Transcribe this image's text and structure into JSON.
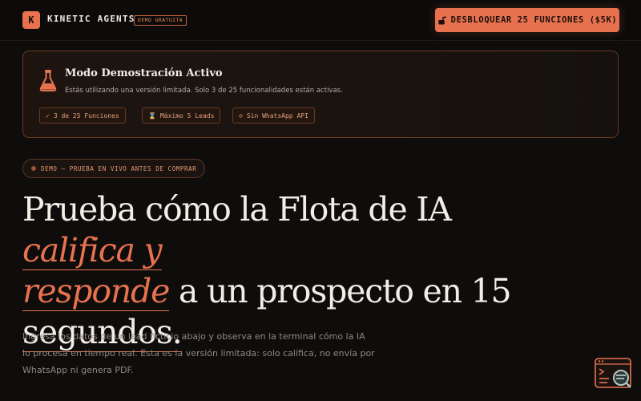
{
  "header": {
    "logo_letter": "K",
    "brand": "KINETIC AGENTS",
    "demo_badge": "DEMO GRATUITA",
    "unlock_label": "DESBLOQUEAR 25 FUNCIONES ($5K)",
    "unlock_icon": "lock-open-icon"
  },
  "demo_card": {
    "icon": "flask-icon",
    "title": "Modo Demostración Activo",
    "subtitle": "Estás utilizando una versión limitada. Solo 3 de 25 funcionalidades están activas.",
    "chips": [
      {
        "icon": "check-icon",
        "label": "3 de 25 Funciones"
      },
      {
        "icon": "hourglass-icon",
        "label": "Máximo 5 Leads"
      },
      {
        "icon": "ban-icon",
        "label": "Sin WhatsApp API"
      }
    ]
  },
  "tag": "DEMO — PRUEBA EN VIVO ANTES DE COMPRAR",
  "hero": {
    "part1": "Prueba cómo la Flota de IA ",
    "highlight1": "califica y",
    "highlight2": "responde",
    "part2": " a un prospecto en 15",
    "highlight3": "segundos.",
    "highlight3_note": ""
  },
  "description": "Ingresa los datos de un lead ficticio abajo y observa en la terminal cómo la IA lo procesa en tiempo real. Esta es la versión limitada: solo califica, no envía por WhatsApp ni genera PDF.",
  "floating_icon": "terminal-search-icon",
  "colors": {
    "accent": "#e8724f",
    "background": "#0f0d0c"
  }
}
